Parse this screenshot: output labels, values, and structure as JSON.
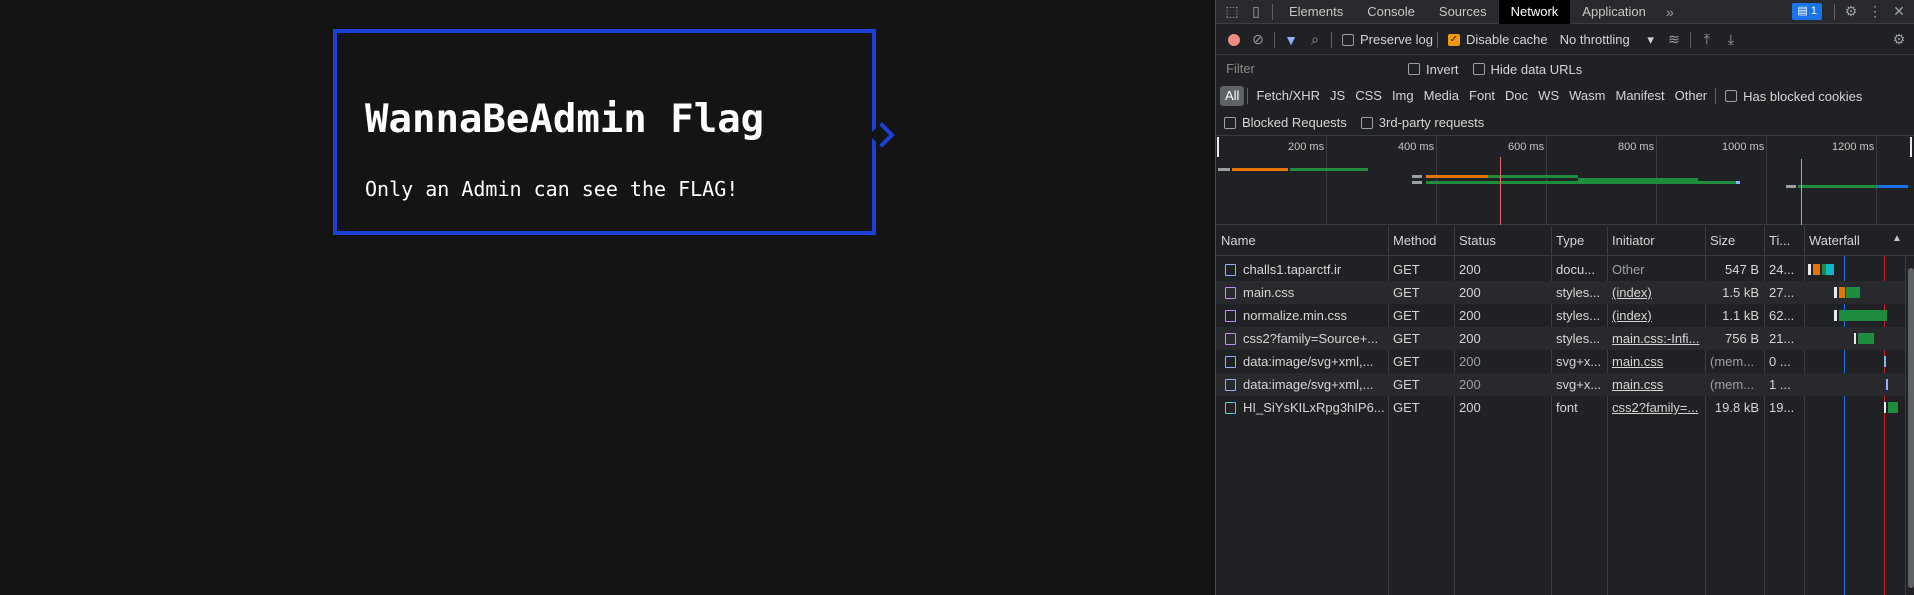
{
  "page": {
    "heading": "WannaBeAdmin Flag",
    "message": "Only an Admin can see the FLAG!"
  },
  "devtools": {
    "tabs": [
      "Elements",
      "Console",
      "Sources",
      "Network",
      "Application"
    ],
    "active_tab": "Network",
    "more_tabs": "»",
    "issues_count": "1",
    "toolbar": {
      "preserve_log": "Preserve log",
      "preserve_log_checked": false,
      "disable_cache": "Disable cache",
      "disable_cache_checked": true,
      "throttling": "No throttling"
    },
    "filter": {
      "placeholder": "Filter",
      "invert": "Invert",
      "hide_data_urls": "Hide data URLs"
    },
    "types": [
      "All",
      "Fetch/XHR",
      "JS",
      "CSS",
      "Img",
      "Media",
      "Font",
      "Doc",
      "WS",
      "Wasm",
      "Manifest",
      "Other"
    ],
    "active_type": "All",
    "has_blocked_cookies": "Has blocked cookies",
    "blocked_requests": "Blocked Requests",
    "third_party": "3rd-party requests",
    "overview_ticks": [
      "200 ms",
      "400 ms",
      "600 ms",
      "800 ms",
      "1000 ms",
      "1200 ms"
    ],
    "columns": [
      "Name",
      "Method",
      "Status",
      "Type",
      "Initiator",
      "Size",
      "Ti...",
      "Waterfall"
    ],
    "requests": [
      {
        "name": "challs1.taparctf.ir",
        "method": "GET",
        "status": "200",
        "type": "docu...",
        "initiator": "Other",
        "size": "547 B",
        "time": "24...",
        "icon": "document-icon",
        "color": "#8ab4f8"
      },
      {
        "name": "main.css",
        "method": "GET",
        "status": "200",
        "type": "styles...",
        "initiator": "(index)",
        "size": "1.5 kB",
        "time": "27...",
        "icon": "stylesheet-icon",
        "color": "#c58af9"
      },
      {
        "name": "normalize.min.css",
        "method": "GET",
        "status": "200",
        "type": "styles...",
        "initiator": "(index)",
        "size": "1.1 kB",
        "time": "62...",
        "icon": "stylesheet-icon",
        "color": "#c58af9"
      },
      {
        "name": "css2?family=Source+...",
        "method": "GET",
        "status": "200",
        "type": "styles...",
        "initiator": "main.css:-Infi...",
        "size": "756 B",
        "time": "21...",
        "icon": "stylesheet-icon",
        "color": "#c58af9"
      },
      {
        "name": "data:image/svg+xml,...",
        "method": "GET",
        "status": "200",
        "type": "svg+x...",
        "initiator": "main.css",
        "size": "(mem...",
        "time": "0 ...",
        "icon": "image-icon",
        "color": "#8ab4f8"
      },
      {
        "name": "data:image/svg+xml,...",
        "method": "GET",
        "status": "200",
        "type": "svg+x...",
        "initiator": "main.css",
        "size": "(mem...",
        "time": "1 ...",
        "icon": "image-icon",
        "color": "#8ab4f8"
      },
      {
        "name": "HI_SiYsKILxRpg3hIP6...",
        "method": "GET",
        "status": "200",
        "type": "font",
        "initiator": "css2?family=...",
        "size": "19.8 kB",
        "time": "19...",
        "icon": "font-icon",
        "color": "#4ecde6"
      }
    ]
  }
}
